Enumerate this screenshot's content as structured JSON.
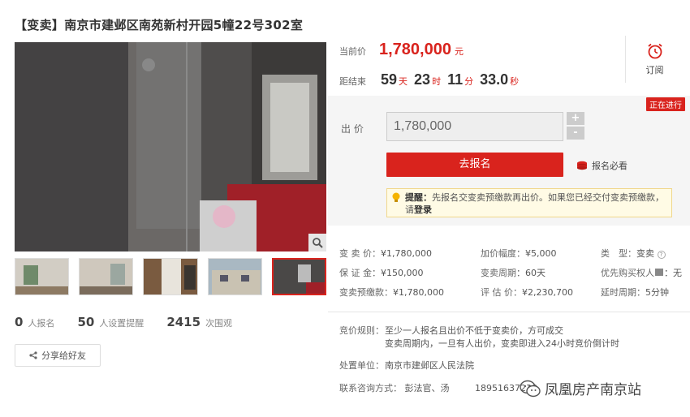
{
  "title": "【变卖】南京市建邺区南苑新村开园5幢22号302室",
  "gallery": {
    "zoom_icon": "magnifier-icon",
    "thumbnails": 5
  },
  "stats": [
    {
      "num": "0",
      "unit": "人报名"
    },
    {
      "num": "50",
      "unit": "人设置提醒"
    },
    {
      "num": "2415",
      "unit": "次围观"
    }
  ],
  "share": {
    "label": "分享给好友",
    "icon": "share-icon"
  },
  "price": {
    "label": "当前价",
    "value": "1,780,000",
    "unit": "元"
  },
  "countdown": {
    "label": "距结束",
    "days": "59",
    "days_unit": "天",
    "hours": "23",
    "hours_unit": "时",
    "minutes": "11",
    "minutes_unit": "分",
    "seconds": "33.0",
    "seconds_unit": "秒"
  },
  "subscribe": {
    "label": "订阅",
    "icon": "alarm-clock-icon"
  },
  "bid": {
    "status": "正在进行",
    "label": "出 价",
    "value": "1,780,000",
    "plus": "+",
    "minus": "-",
    "signup": "去报名",
    "must_read": "报名必看",
    "notice_bold": "提醒：",
    "notice_text": "先报名交变卖预缴款再出价。如果您已经交付变卖预缴款，",
    "notice_text2": "请",
    "notice_login": "登录"
  },
  "info": {
    "r1": [
      {
        "k": "变 卖 价：",
        "v": "¥1,780,000"
      },
      {
        "k": "加价幅度：",
        "v": "¥5,000"
      },
      {
        "k": "类　型：",
        "v": "变卖"
      }
    ],
    "r2": [
      {
        "k": "保 证 金：",
        "v": "¥150,000"
      },
      {
        "k": "变卖周期：",
        "v": "60天"
      },
      {
        "k": "优先购买权人",
        "v": "：无"
      }
    ],
    "r3": [
      {
        "k": "变卖预缴款：",
        "v": "¥1,780,000"
      },
      {
        "k": "评 估 价：",
        "v": "¥2,230,700"
      },
      {
        "k": "延时周期：",
        "v": "5分钟"
      }
    ]
  },
  "rules": {
    "label": "竞价规则：",
    "line1": "至少一人报名且出价不低于变卖价，方可成交",
    "line2": "变卖周期内，一旦有人出价，变卖即进入24小时竞价倒计时"
  },
  "court": {
    "label": "处置单位：",
    "value": "南京市建邺区人民法院"
  },
  "contact": {
    "label": "联系咨询方式：",
    "names": "彭法官、汤",
    "phone": "18951637238"
  },
  "watermark": {
    "text": "凤凰房产南京站",
    "icon": "wechat-icon"
  },
  "colors": {
    "accent": "#d9231d",
    "notice_bg": "#fffbe5"
  }
}
